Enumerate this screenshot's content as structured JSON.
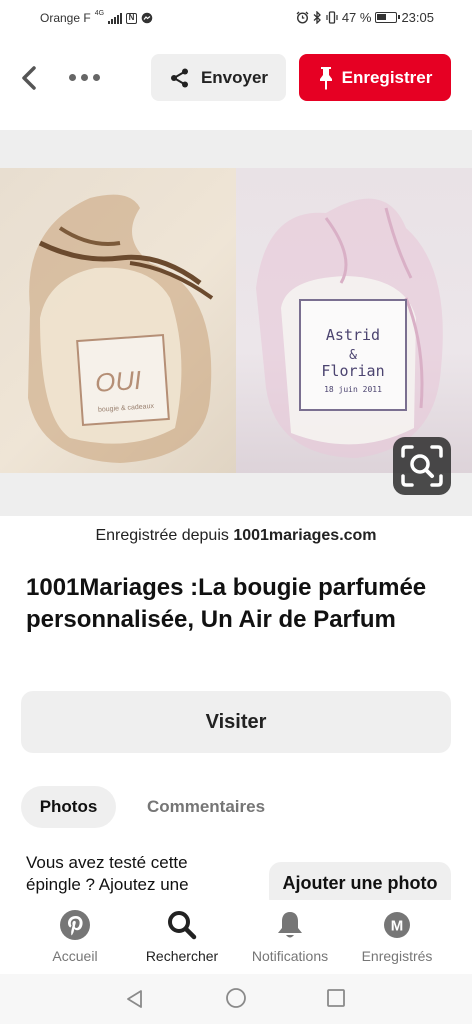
{
  "status_bar": {
    "carrier": "Orange F",
    "network": "4G",
    "nfc": "N",
    "battery_percent": "47 %",
    "time": "23:05"
  },
  "toolbar": {
    "send_label": "Envoyer",
    "save_label": "Enregistrer"
  },
  "photo": {
    "left_jar_label": "OUI",
    "left_jar_small": "bougie & cadeaux",
    "right_jar_line1": "Astrid",
    "right_jar_line2": "&",
    "right_jar_line3": "Florian",
    "right_jar_date": "18 juin 2011"
  },
  "source": {
    "prefix": "Enregistrée depuis ",
    "domain": "1001mariages.com"
  },
  "pin": {
    "title": "1001Mariages :La bougie parfumée personnalisée, Un Air de Parfum",
    "visit_label": "Visiter"
  },
  "tabs": {
    "photos": "Photos",
    "comments": "Commentaires"
  },
  "tried": {
    "prompt": "Vous avez testé cette épingle ? Ajoutez une photo pour montrer",
    "add_label": "Ajouter une photo"
  },
  "bottom_nav": {
    "home": "Accueil",
    "search": "Rechercher",
    "notifications": "Notifications",
    "saved": "Enregistrés",
    "saved_avatar_letter": "M"
  },
  "colors": {
    "brand_red": "#e60023",
    "button_gray": "#efefef"
  }
}
